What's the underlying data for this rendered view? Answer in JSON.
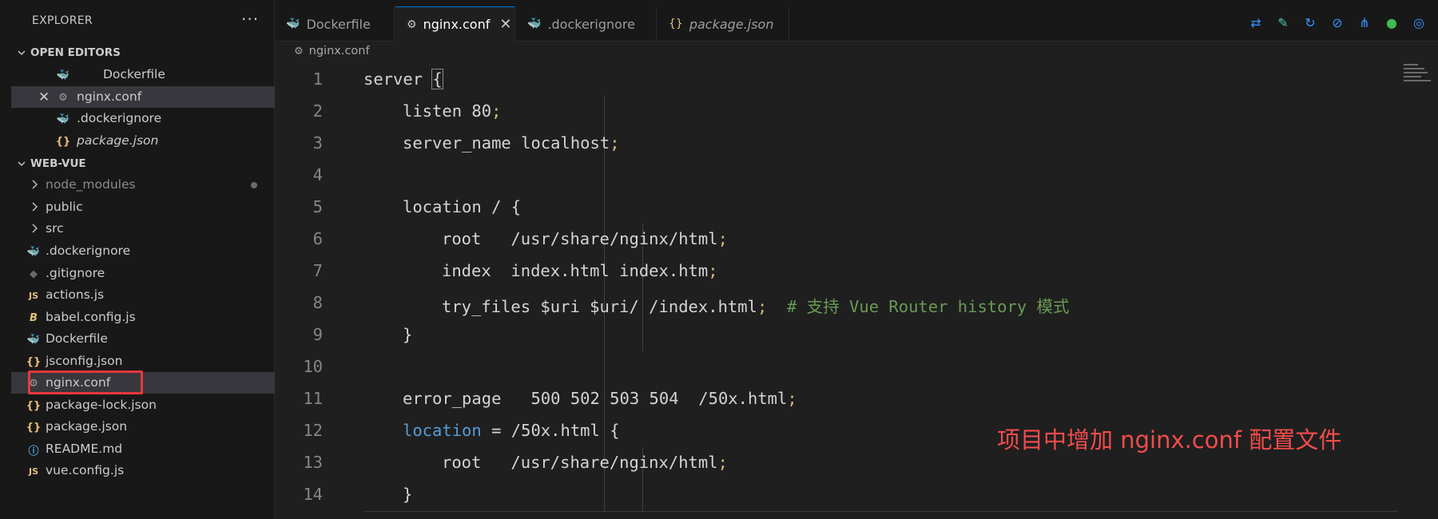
{
  "sidebar": {
    "title": "EXPLORER",
    "more_label": "···",
    "open_editors_title": "OPEN EDITORS",
    "open_editors": [
      {
        "name": "Dockerfile",
        "icon": "docker-icon",
        "italic": false
      },
      {
        "name": "nginx.conf",
        "icon": "gear-icon",
        "italic": false
      },
      {
        "name": ".dockerignore",
        "icon": "docker-icon",
        "italic": false
      },
      {
        "name": "package.json",
        "icon": "json-icon",
        "italic": true
      }
    ],
    "workspace_title": "WEB-VUE",
    "folders": [
      {
        "name": "node_modules",
        "dimmed": true
      },
      {
        "name": "public",
        "dimmed": false
      },
      {
        "name": "src",
        "dimmed": false
      }
    ],
    "files": [
      {
        "name": ".dockerignore",
        "icon": "docker-icon"
      },
      {
        "name": ".gitignore",
        "icon": "git-icon"
      },
      {
        "name": "actions.js",
        "icon": "js-icon"
      },
      {
        "name": "babel.config.js",
        "icon": "babel-icon"
      },
      {
        "name": "Dockerfile",
        "icon": "docker-icon"
      },
      {
        "name": "jsconfig.json",
        "icon": "json-icon"
      },
      {
        "name": "nginx.conf",
        "icon": "gear-icon"
      },
      {
        "name": "package-lock.json",
        "icon": "json-icon"
      },
      {
        "name": "package.json",
        "icon": "json-icon"
      },
      {
        "name": "README.md",
        "icon": "info-icon"
      },
      {
        "name": "vue.config.js",
        "icon": "js-icon"
      }
    ]
  },
  "tabs": [
    {
      "label": "Dockerfile",
      "icon": "docker-icon",
      "active": false,
      "italic": false
    },
    {
      "label": "nginx.conf",
      "icon": "gear-icon",
      "active": true,
      "italic": false
    },
    {
      "label": ".dockerignore",
      "icon": "docker-icon",
      "active": false,
      "italic": false
    },
    {
      "label": "package.json",
      "icon": "json-icon",
      "active": false,
      "italic": true
    }
  ],
  "tab_close": "✕",
  "breadcrumb": {
    "file": "nginx.conf"
  },
  "code": {
    "line_numbers": [
      "1",
      "2",
      "3",
      "4",
      "5",
      "6",
      "7",
      "8",
      "9",
      "10",
      "11",
      "12",
      "13",
      "14"
    ],
    "l1": "server ",
    "l1_brace": "{",
    "l2": "listen 80",
    "l3": "server_name localhost",
    "l5": "location / {",
    "l6": "root   /usr/share/nginx/html",
    "l7": "index  index.html index.htm",
    "l8": "try_files $uri $uri/ /index.html",
    "l8_comment": "# 支持 Vue Router history 模式",
    "l9": "}",
    "l11": "error_page   500 502 503 504  /50x.html",
    "l12_kw": "location",
    "l12": " = /50x.html {",
    "l13": "root   /usr/share/nginx/html",
    "l14": "}",
    "semicolon": ";"
  },
  "annotation": "项目中增加 nginx.conf 配置文件",
  "colors": {
    "accent": "#0078d4",
    "annotation": "#f14c4c",
    "highlight_box": "#e8383d"
  }
}
